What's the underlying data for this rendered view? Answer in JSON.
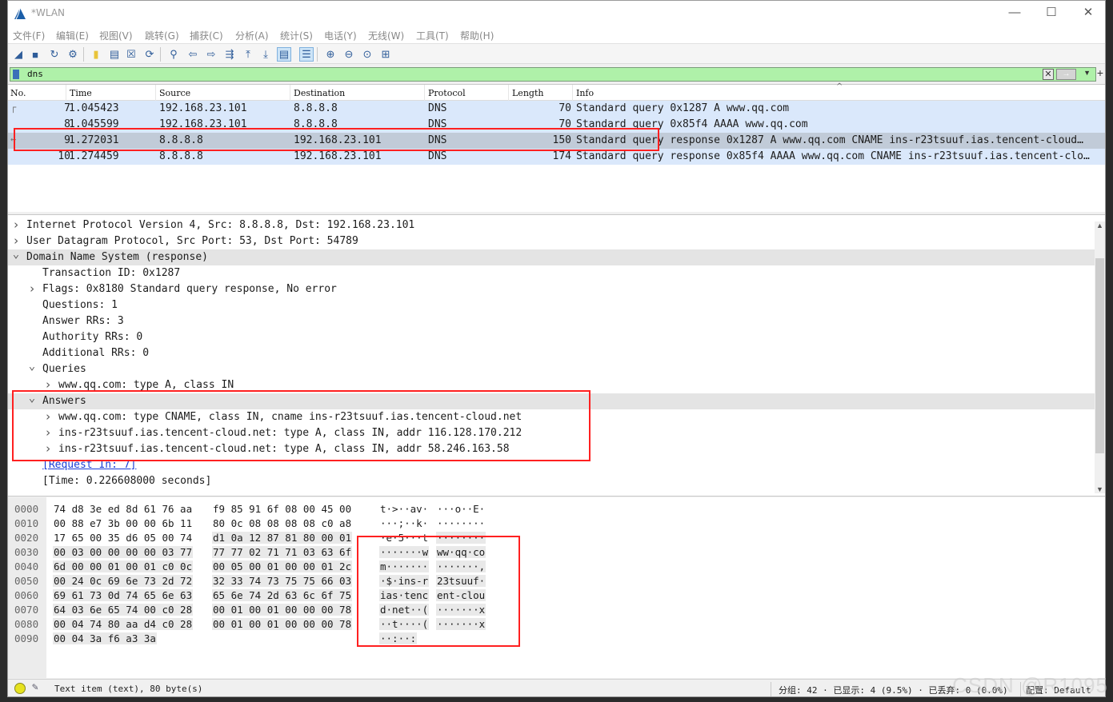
{
  "window": {
    "title": "*WLAN",
    "min": "—",
    "max": "☐",
    "close": "✕"
  },
  "menu": [
    "文件(F)",
    "编辑(E)",
    "视图(V)",
    "跳转(G)",
    "捕获(C)",
    "分析(A)",
    "统计(S)",
    "电话(Y)",
    "无线(W)",
    "工具(T)",
    "帮助(H)"
  ],
  "toolbar": [
    "shark-fin-start-icon",
    "stop-icon",
    "restart-icon",
    "options-gear-icon",
    "open-folder-icon",
    "save-icon",
    "close-file-icon",
    "reload-icon",
    "find-icon",
    "go-back-icon",
    "go-forward-icon",
    "go-to-packet-icon",
    "first-packet-icon",
    "last-packet-icon",
    "autoscroll-icon",
    "colorize-icon",
    "zoom-in-icon",
    "zoom-out-icon",
    "normal-size-icon",
    "resize-columns-icon"
  ],
  "filter": {
    "value": "dns",
    "apply": "→",
    "plus": "+"
  },
  "columns": {
    "no": "No.",
    "time": "Time",
    "source": "Source",
    "destination": "Destination",
    "protocol": "Protocol",
    "length": "Length",
    "info": "Info"
  },
  "packets": [
    {
      "no": "7",
      "time": "1.045423",
      "source": "192.168.23.101",
      "destination": "8.8.8.8",
      "protocol": "DNS",
      "length": "70",
      "info": "Standard query 0x1287 A www.qq.com"
    },
    {
      "no": "8",
      "time": "1.045599",
      "source": "192.168.23.101",
      "destination": "8.8.8.8",
      "protocol": "DNS",
      "length": "70",
      "info": "Standard query 0x85f4 AAAA www.qq.com"
    },
    {
      "no": "9",
      "time": "1.272031",
      "source": "8.8.8.8",
      "destination": "192.168.23.101",
      "protocol": "DNS",
      "length": "150",
      "info": "Standard query response 0x1287 A www.qq.com CNAME ins-r23tsuuf.ias.tencent-cloud…"
    },
    {
      "no": "10",
      "time": "1.274459",
      "source": "8.8.8.8",
      "destination": "192.168.23.101",
      "protocol": "DNS",
      "length": "174",
      "info": "Standard query response 0x85f4 AAAA www.qq.com CNAME ins-r23tsuuf.ias.tencent-clo…"
    }
  ],
  "details": [
    {
      "text": "Internet Protocol Version 4, Src: 8.8.8.8, Dst: 192.168.23.101",
      "arrow": ">"
    },
    {
      "text": "User Datagram Protocol, Src Port: 53, Dst Port: 54789",
      "arrow": ">"
    },
    {
      "text": "Domain Name System (response)",
      "arrow": "v"
    },
    {
      "text": "Transaction ID: 0x1287",
      "arrow": ""
    },
    {
      "text": "Flags: 0x8180 Standard query response, No error",
      "arrow": ">"
    },
    {
      "text": "Questions: 1",
      "arrow": ""
    },
    {
      "text": "Answer RRs: 3",
      "arrow": ""
    },
    {
      "text": "Authority RRs: 0",
      "arrow": ""
    },
    {
      "text": "Additional RRs: 0",
      "arrow": ""
    },
    {
      "text": "Queries",
      "arrow": "v"
    },
    {
      "text": "www.qq.com: type A, class IN",
      "arrow": ">"
    },
    {
      "text": "Answers",
      "arrow": "v"
    },
    {
      "text": "www.qq.com: type CNAME, class IN, cname ins-r23tsuuf.ias.tencent-cloud.net",
      "arrow": ">"
    },
    {
      "text": "ins-r23tsuuf.ias.tencent-cloud.net: type A, class IN, addr 116.128.170.212",
      "arrow": ">"
    },
    {
      "text": "ins-r23tsuuf.ias.tencent-cloud.net: type A, class IN, addr 58.246.163.58",
      "arrow": ">"
    },
    {
      "text": "[Request In: 7]",
      "arrow": ""
    },
    {
      "text": "[Time: 0.226608000 seconds]",
      "arrow": ""
    }
  ],
  "bytes": [
    {
      "off": "0000",
      "h1": "74 d8 3e ed 8d 61 76 aa",
      "h2": "f9 85 91 6f 08 00 45 00",
      "a1": "t·>··av·",
      "a2": "···o··E·"
    },
    {
      "off": "0010",
      "h1": "00 88 e7 3b 00 00 6b 11",
      "h2": "80 0c 08 08 08 08 c0 a8",
      "a1": "···;··k·",
      "a2": "········"
    },
    {
      "off": "0020",
      "h1": "17 65 00 35 d6 05 00 74",
      "h2": "d1 0a 12 87 81 80 00 01",
      "a1": "·e·5···t",
      "a2": "········"
    },
    {
      "off": "0030",
      "h1": "00 03 00 00 00 00 03 77",
      "h2": "77 77 02 71 71 03 63 6f",
      "a1": "·······w",
      "a2": "ww·qq·co"
    },
    {
      "off": "0040",
      "h1": "6d 00 00 01 00 01 c0 0c",
      "h2": "00 05 00 01 00 00 01 2c",
      "a1": "m·······",
      "a2": "·······,"
    },
    {
      "off": "0050",
      "h1": "00 24 0c 69 6e 73 2d 72",
      "h2": "32 33 74 73 75 75 66 03",
      "a1": "·$·ins-r",
      "a2": "23tsuuf·"
    },
    {
      "off": "0060",
      "h1": "69 61 73 0d 74 65 6e 63",
      "h2": "65 6e 74 2d 63 6c 6f 75",
      "a1": "ias·tenc",
      "a2": "ent-clou"
    },
    {
      "off": "0070",
      "h1": "64 03 6e 65 74 00 c0 28",
      "h2": "00 01 00 01 00 00 00 78",
      "a1": "d·net··(",
      "a2": "·······x"
    },
    {
      "off": "0080",
      "h1": "00 04 74 80 aa d4 c0 28",
      "h2": "00 01 00 01 00 00 00 78",
      "a1": "··t····(",
      "a2": "·······x"
    },
    {
      "off": "0090",
      "h1": "00 04 3a f6 a3 3a",
      "h2": "",
      "a1": "··:··:",
      "a2": ""
    }
  ],
  "status": {
    "text": "Text item (text), 80 byte(s)",
    "packets": "分组: 42 · 已显示: 4 (9.5%) · 已丢弃: 0 (0.0%)",
    "profile": "配置: Default"
  },
  "watermark": "CSDN @R1095",
  "colors": {
    "filter_ok": "#aff1a9",
    "selected_row": "#c1cbd8",
    "dns_row": "#dae8fb",
    "annotation": "#ff2020"
  }
}
